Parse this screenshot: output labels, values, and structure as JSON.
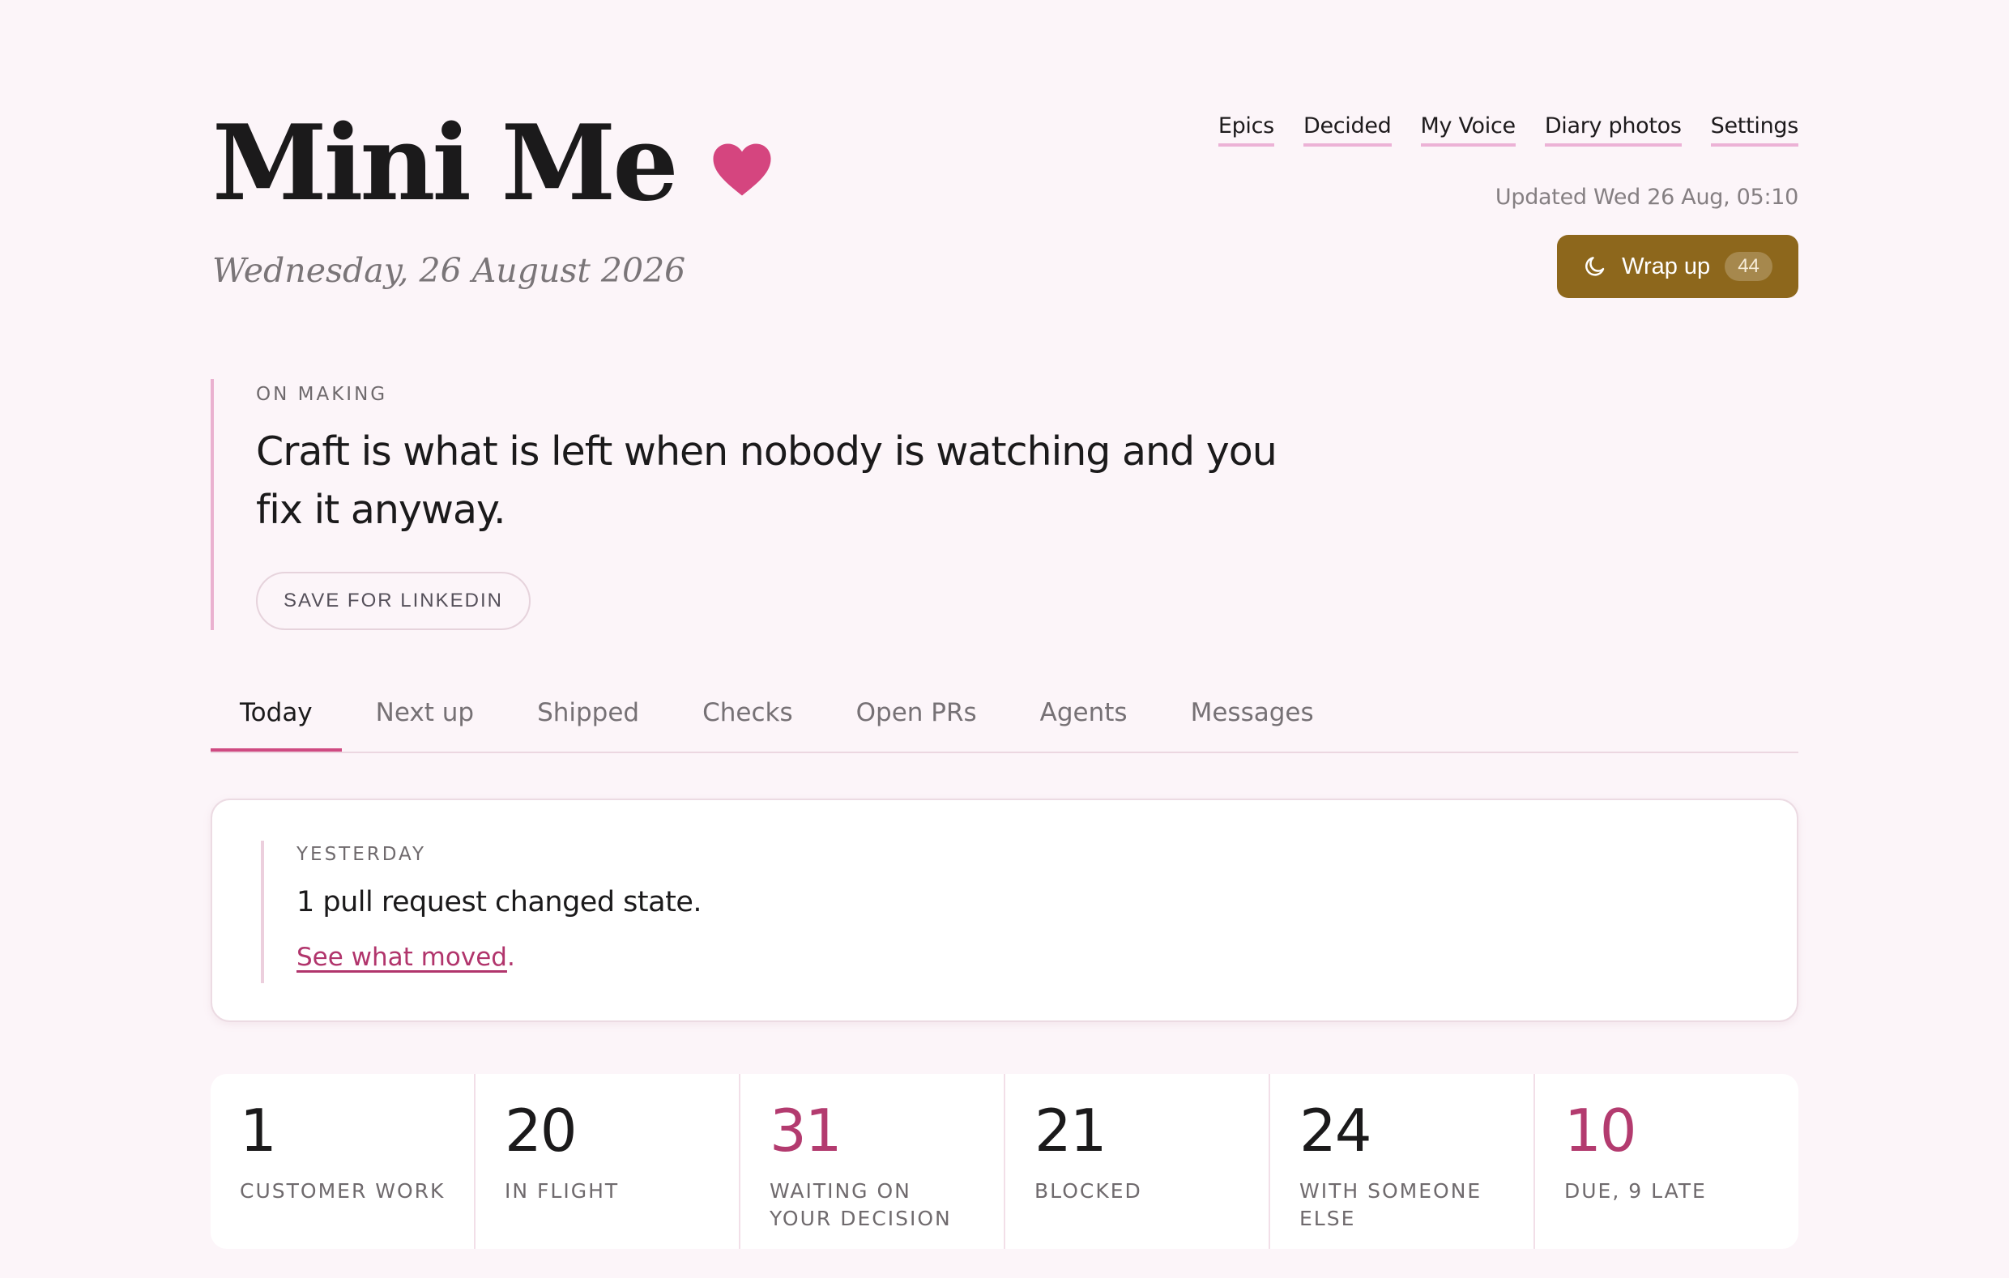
{
  "app": {
    "title": "Mini Me",
    "date": "Wednesday, 26 August 2026",
    "heart_color": "#d5457f"
  },
  "nav": {
    "items": [
      "Epics",
      "Decided",
      "My Voice",
      "Diary photos",
      "Settings"
    ]
  },
  "status": {
    "updated": "Updated Wed 26 Aug, 05:10"
  },
  "wrap_up": {
    "label": "Wrap up",
    "count": "44",
    "color": "#8d671c"
  },
  "quote": {
    "eyebrow": "ON MAKING",
    "text": "Craft is what is left when nobody is watching and you fix it anyway.",
    "save_label": "SAVE FOR LINKEDIN"
  },
  "tabs": {
    "items": [
      "Today",
      "Next up",
      "Shipped",
      "Checks",
      "Open PRs",
      "Agents",
      "Messages"
    ],
    "active": "Today"
  },
  "yesterday": {
    "eyebrow": "YESTERDAY",
    "text": "1 pull request changed state.",
    "link": "See what moved",
    "link_suffix": "."
  },
  "stats": [
    {
      "value": "1",
      "label": "CUSTOMER WORK"
    },
    {
      "value": "20",
      "label": "IN FLIGHT"
    },
    {
      "value": "31",
      "label": "WAITING ON YOUR DECISION"
    },
    {
      "value": "21",
      "label": "BLOCKED"
    },
    {
      "value": "24",
      "label": "WITH SOMEONE ELSE"
    },
    {
      "value": "10",
      "label": "DUE, 9 LATE"
    }
  ],
  "accent_color": "#b33b6f"
}
